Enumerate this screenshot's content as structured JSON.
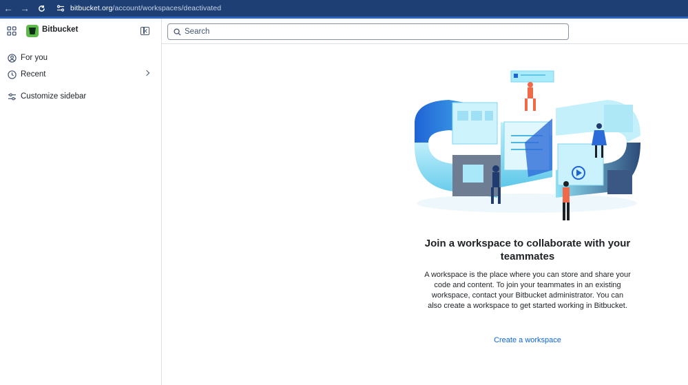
{
  "browser": {
    "url_host": "bitbucket.org",
    "url_path": "/account/workspaces/deactivated"
  },
  "header": {
    "product_name": "Bitbucket",
    "search": {
      "placeholder": "Search",
      "value": ""
    }
  },
  "sidebar": {
    "items": [
      {
        "label": "For you",
        "icon": "user-circle-icon"
      },
      {
        "label": "Recent",
        "icon": "clock-icon",
        "has_chevron": true
      },
      {
        "label": "Customize sidebar",
        "icon": "sliders-icon"
      }
    ]
  },
  "main": {
    "title": "Join a workspace to collaborate with your teammates",
    "description": "A workspace is the place where you can store and share your code and content. To join your teammates in an existing workspace, contact your Bitbucket administrator. You can also create a workspace to get started working in Bitbucket.",
    "create_link": "Create a workspace"
  },
  "colors": {
    "browser_bar": "#1e3f73",
    "brand_green": "#5eb84a",
    "link_blue": "#0c66e4",
    "text": "#1d2125"
  }
}
